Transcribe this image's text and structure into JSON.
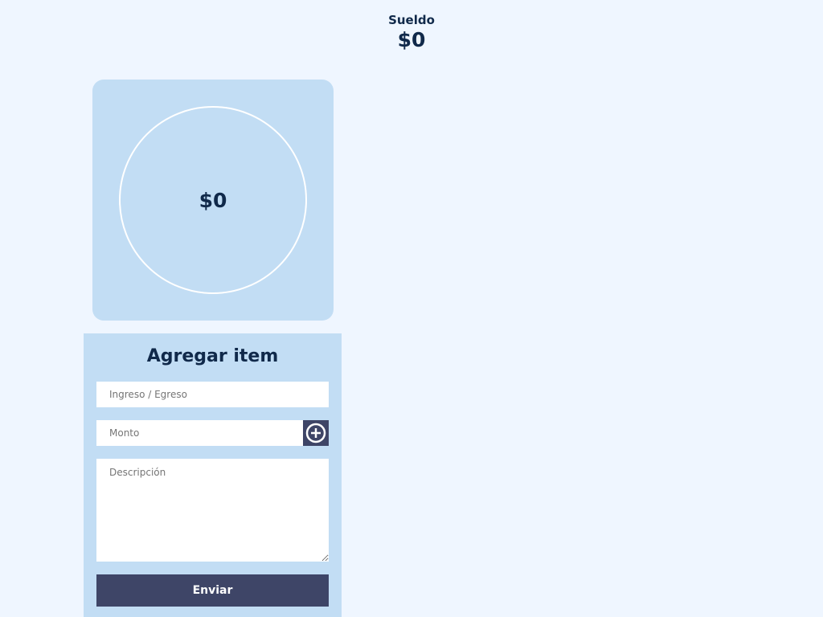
{
  "header": {
    "label": "Sueldo",
    "amount": "$0"
  },
  "balance": {
    "amount": "$0"
  },
  "form": {
    "title": "Agregar item",
    "type_placeholder": "Ingreso / Egreso",
    "amount_placeholder": "Monto",
    "description_placeholder": "Descripción",
    "add_icon": "plus-circle-icon",
    "submit_label": "Enviar"
  },
  "colors": {
    "background": "#eff6ff",
    "card": "#c2ddf4",
    "accent": "#3e4567",
    "text": "#10294a"
  }
}
